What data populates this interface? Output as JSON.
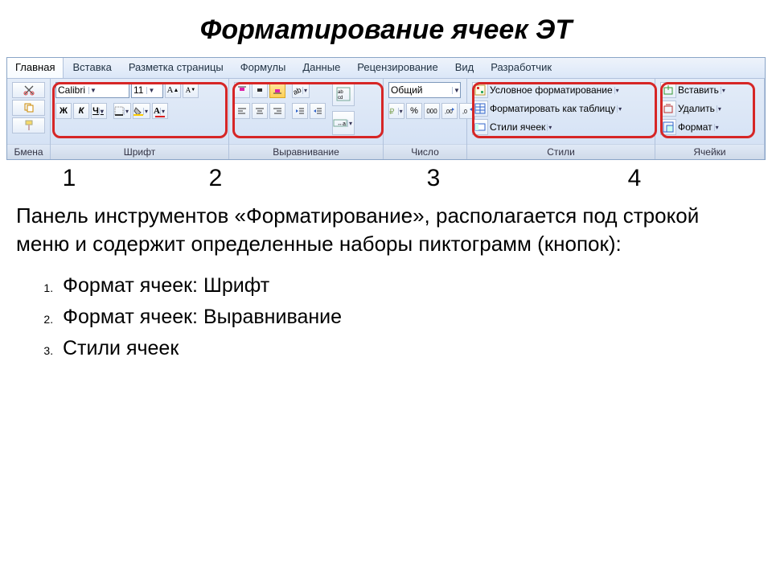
{
  "title": "Форматирование ячеек ЭТ",
  "tabs": [
    "Главная",
    "Вставка",
    "Разметка страницы",
    "Формулы",
    "Данные",
    "Рецензирование",
    "Вид",
    "Разработчик"
  ],
  "clipboard_label": "Бмена",
  "font": {
    "name": "Calibri",
    "size": "11",
    "bold": "Ж",
    "italic": "К",
    "underline": "Ч",
    "label": "Шрифт"
  },
  "align": {
    "label": "Выравнивание"
  },
  "number": {
    "fmt": "Общий",
    "pct": "%",
    "thousands": "000",
    "label": "Число"
  },
  "styles": {
    "cond": "Условное форматирование",
    "table": "Форматировать как таблицу",
    "cell": "Стили ячеек",
    "label": "Стили"
  },
  "cells": {
    "ins": "Вставить",
    "del": "Удалить",
    "fmt": "Формат",
    "label": "Ячейки"
  },
  "nums": [
    "1",
    "2",
    "3",
    "4"
  ],
  "para": "Панель инструментов «Форматирование», располагается под строкой меню и содержит определенные наборы пиктограмм (кнопок):",
  "list": [
    "Формат ячеек: Шрифт",
    "Формат ячеек: Выравнивание",
    "Стили ячеек"
  ]
}
